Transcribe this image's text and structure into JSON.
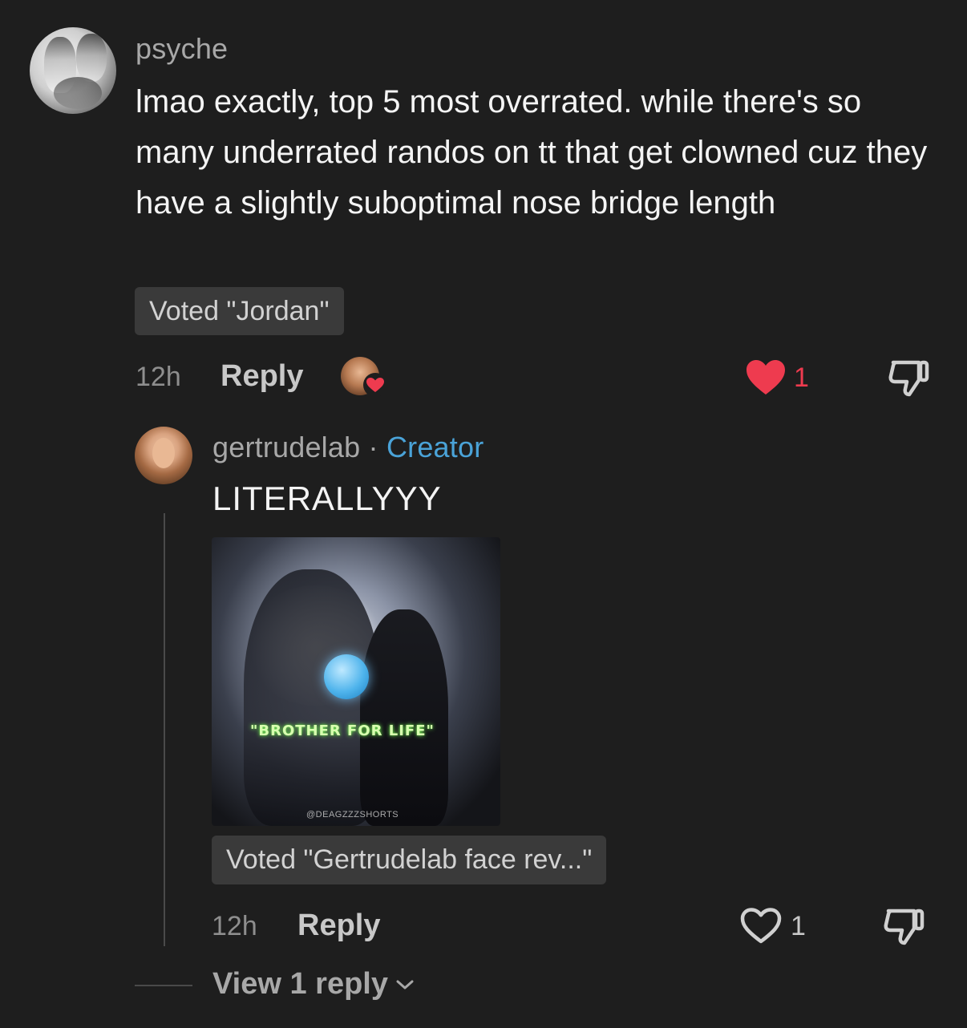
{
  "comment": {
    "username": "psyche",
    "text": "lmao exactly, top 5 most overrated. while there's so many underrated randos on tt that get clowned cuz they have a slightly suboptimal nose bridge length",
    "vote_badge": "Voted \"Jordan\"",
    "time": "12h",
    "reply_label": "Reply",
    "like_count": "1",
    "liked": true,
    "like_color": "#ee3b4f"
  },
  "reply": {
    "username": "gertrudelab",
    "separator": "·",
    "creator_label": "Creator",
    "text": "LITERALLYYY",
    "media_caption": "\"BROTHER FOR LIFE\"",
    "media_watermark": "@DEAGZZZSHORTS",
    "vote_badge": "Voted \"Gertrudelab face rev...\"",
    "time": "12h",
    "reply_label": "Reply",
    "like_count": "1",
    "liked": false
  },
  "thread": {
    "view_replies_label": "View 1 reply"
  },
  "colors": {
    "background": "#1e1e1e",
    "creator": "#4aa3d8",
    "like": "#ee3b4f"
  }
}
